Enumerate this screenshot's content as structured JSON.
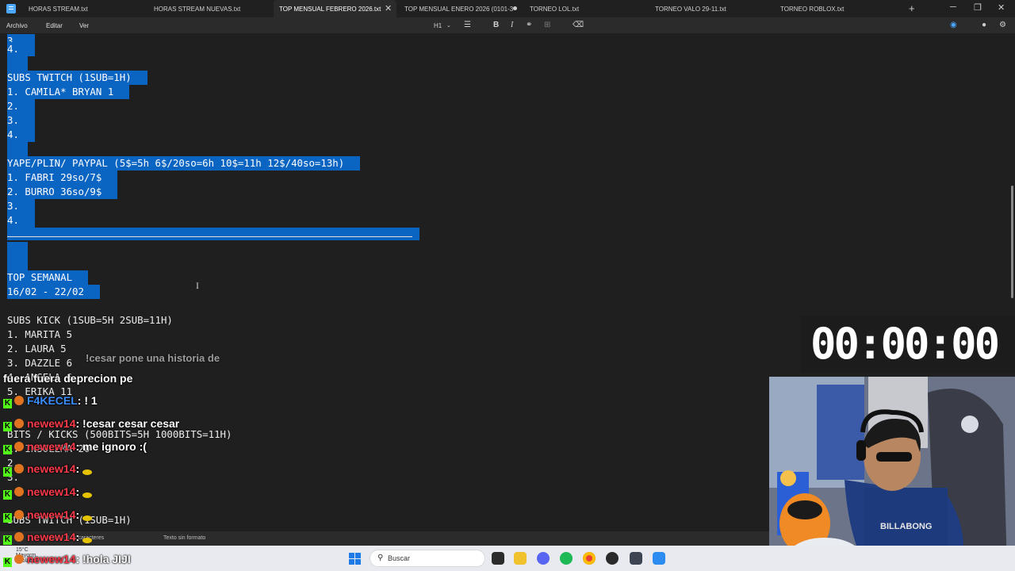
{
  "tabs": [
    {
      "label": "HORAS STREAM.txt"
    },
    {
      "label": "HORAS STREAM NUEVAS.txt"
    },
    {
      "label": "TOP MENSUAL FEBRERO 2026.txt",
      "active": true
    },
    {
      "label": "TOP MENSUAL ENERO 2026 (0101-3"
    },
    {
      "label": "TORNEO LOL.txt"
    },
    {
      "label": "TORNEO VALO 29-11.txt"
    },
    {
      "label": "TORNEO ROBLOX.txt"
    }
  ],
  "menu": {
    "archivo": "Archivo",
    "editar": "Editar",
    "ver": "Ver",
    "heading": "H1"
  },
  "editor": {
    "lines": [
      "3.",
      "4.",
      "SUBS TWITCH (1SUB=1H)",
      "1. CAMILA* BRYAN 1",
      "2.",
      "3.",
      "4.",
      "YAPE/PLIN/ PAYPAL (5$=5h 6$/20so=6h 10$=11h 12$/40so=13h)",
      "1. FABRI 29so/7$",
      "2. BURRO 36so/9$",
      "3.",
      "4.",
      "TOP SEMANAL",
      "16/02 - 22/02",
      "SUBS KICK (1SUB=5H 2SUB=11H)",
      "1. MARITA 5",
      "2. LAURA 5",
      "3. DAZZLE 6",
      "4. ANGELA 6",
      "5. ERIKA 11",
      "BITS / KICKS (500BITS=5H 1000BITS=11H)",
      "1. INSOLEMA 20",
      "2.",
      "3.",
      "SUBS TWITCH (1SUB=1H)"
    ]
  },
  "status": {
    "chars": "n. car. · 4.3k caracteres",
    "format": "Texto sin formato"
  },
  "timer": "00:00:00",
  "chat": [
    {
      "user": "",
      "text": "!cesar pone una historia de"
    },
    {
      "user": "",
      "text": "fuera fuera deprecion pe"
    },
    {
      "user": "F4KECEL",
      "text": ": ! 1",
      "color": "blue"
    },
    {
      "user": "newew14",
      "text": ": !cesar cesar cesar"
    },
    {
      "user": "newew14",
      "text": ": me ignoro :("
    },
    {
      "user": "newew14",
      "text": ":"
    },
    {
      "user": "newew14",
      "text": ":"
    },
    {
      "user": "newew14",
      "text": ":"
    },
    {
      "user": "newew14",
      "text": ":"
    },
    {
      "user": "newew14",
      "text": ": !hola JIJI"
    }
  ],
  "taskbar": {
    "search_placeholder": "Buscar",
    "weather": "15°C",
    "weather_desc": "Mayorm. nublado"
  },
  "colors": {
    "selection": "#0a64c2",
    "kick_badge": "#53fc18",
    "username": "#ff3a4a",
    "editor_bg": "#1f1f1f"
  }
}
